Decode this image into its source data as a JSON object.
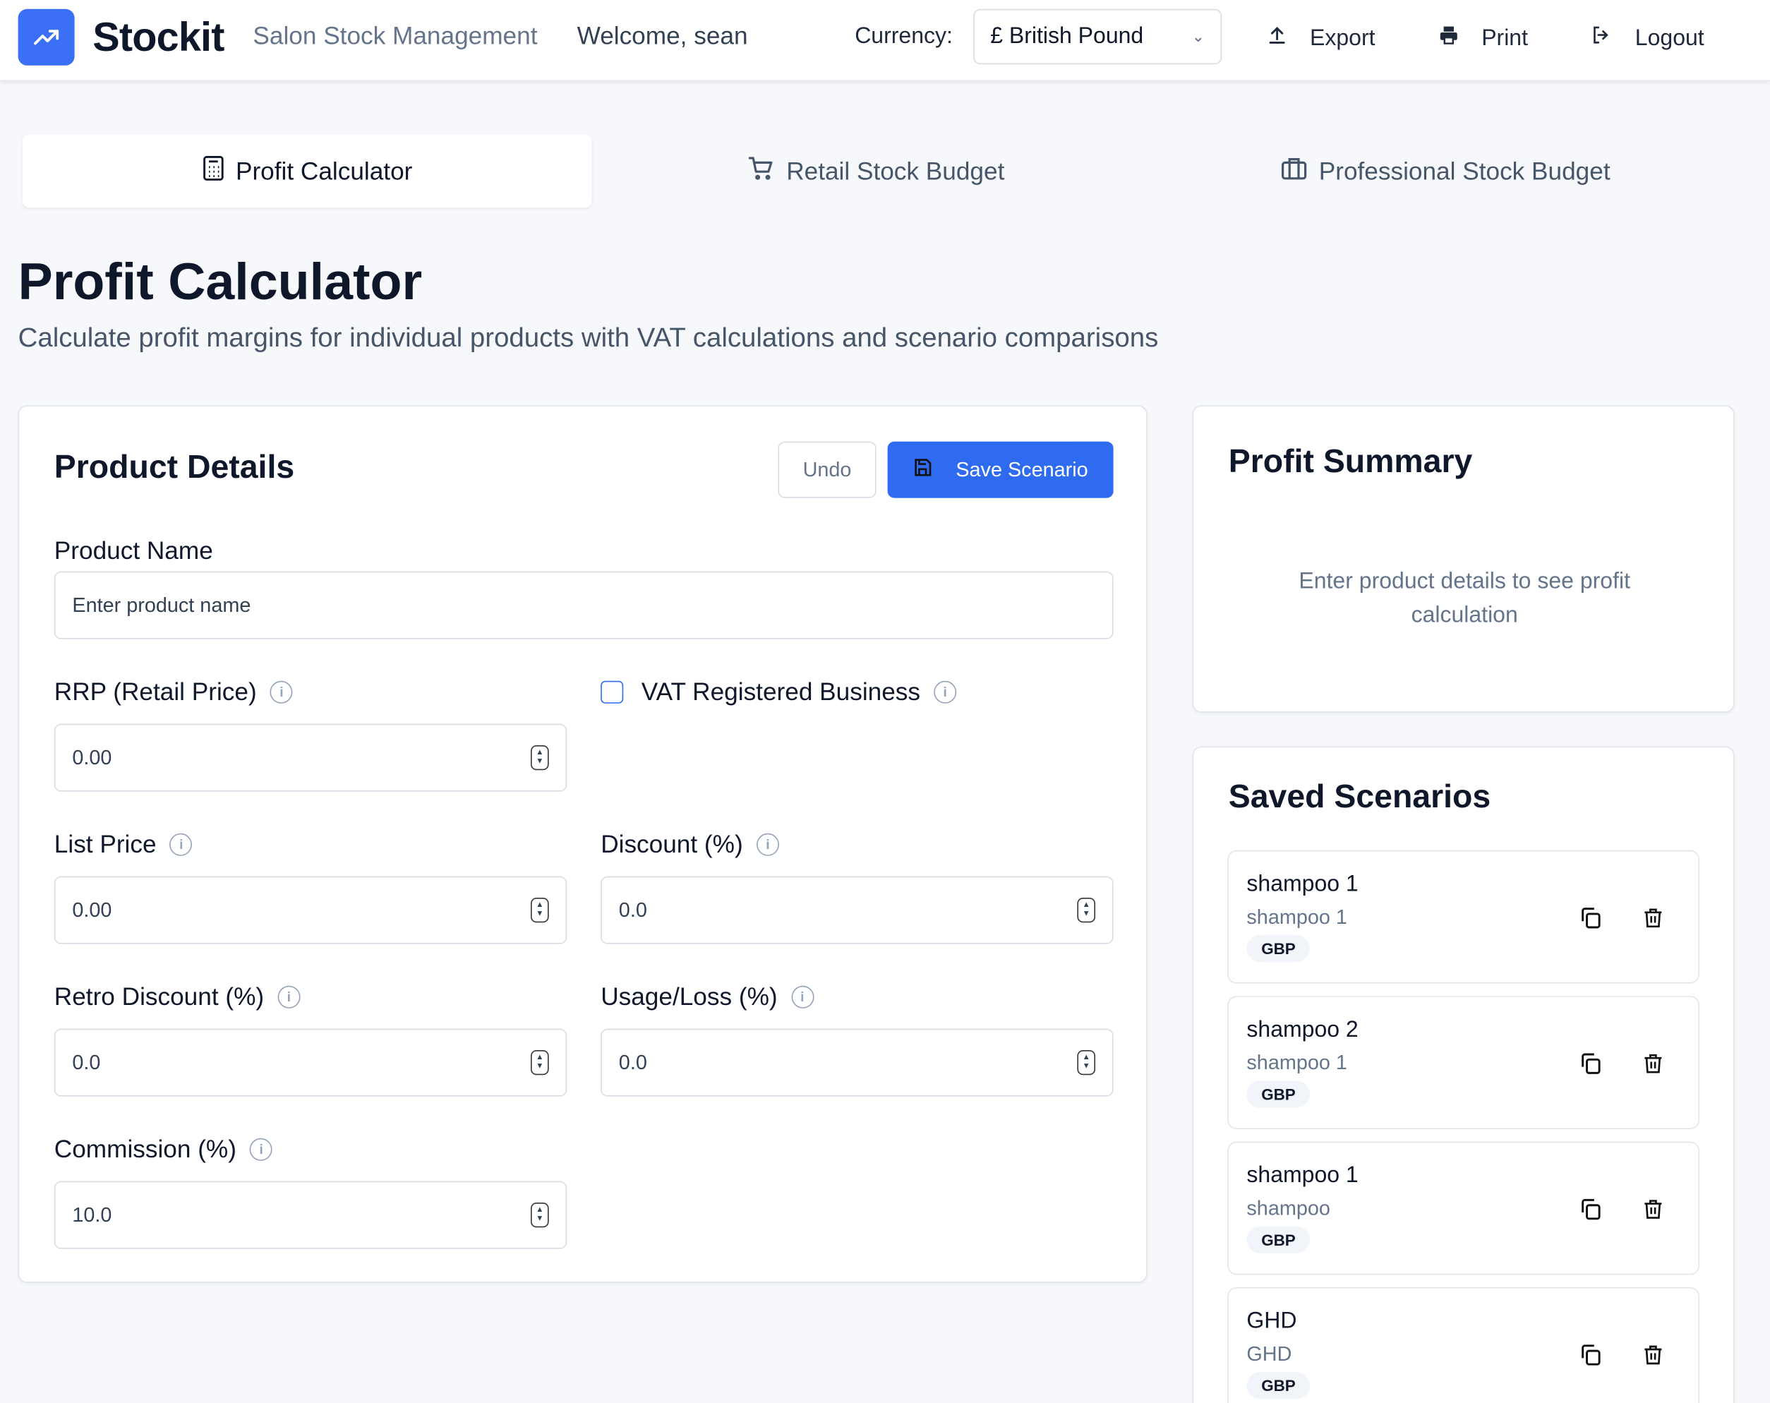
{
  "header": {
    "brand": "Stockit",
    "tagline": "Salon Stock Management",
    "welcome": "Welcome, sean",
    "currency_label": "Currency:",
    "currency_value": "£ British Pound",
    "export": "Export",
    "print": "Print",
    "logout": "Logout",
    "accent": "#3b6ff5"
  },
  "tabs": [
    {
      "label": "Profit Calculator",
      "active": true
    },
    {
      "label": "Retail Stock Budget"
    },
    {
      "label": "Professional Stock Budget"
    }
  ],
  "page": {
    "title": "Profit Calculator",
    "subtitle": "Calculate profit margins for individual products with VAT calculations and scenario comparisons"
  },
  "product": {
    "title": "Product Details",
    "undo": "Undo",
    "save": "Save Scenario",
    "name_label": "Product Name",
    "name_placeholder": "Enter product name",
    "rrp_label": "RRP (Retail Price)",
    "rrp": "0.00",
    "vat_label": "VAT Registered Business",
    "vat_checked": false,
    "list_label": "List Price",
    "list": "0.00",
    "discount_label": "Discount (%)",
    "discount": "0.0",
    "retro_label": "Retro Discount (%)",
    "retro": "0.0",
    "usage_label": "Usage/Loss (%)",
    "usage": "0.0",
    "commission_label": "Commission (%)",
    "commission": "10.0"
  },
  "summary": {
    "title": "Profit Summary",
    "empty": "Enter product details to see profit calculation"
  },
  "saved": {
    "title": "Saved Scenarios",
    "items": [
      {
        "name": "shampoo 1",
        "product": "shampoo 1",
        "currency": "GBP"
      },
      {
        "name": "shampoo 2",
        "product": "shampoo 1",
        "currency": "GBP"
      },
      {
        "name": "shampoo 1",
        "product": "shampoo",
        "currency": "GBP"
      },
      {
        "name": "GHD",
        "product": "GHD",
        "currency": "GBP"
      }
    ]
  }
}
